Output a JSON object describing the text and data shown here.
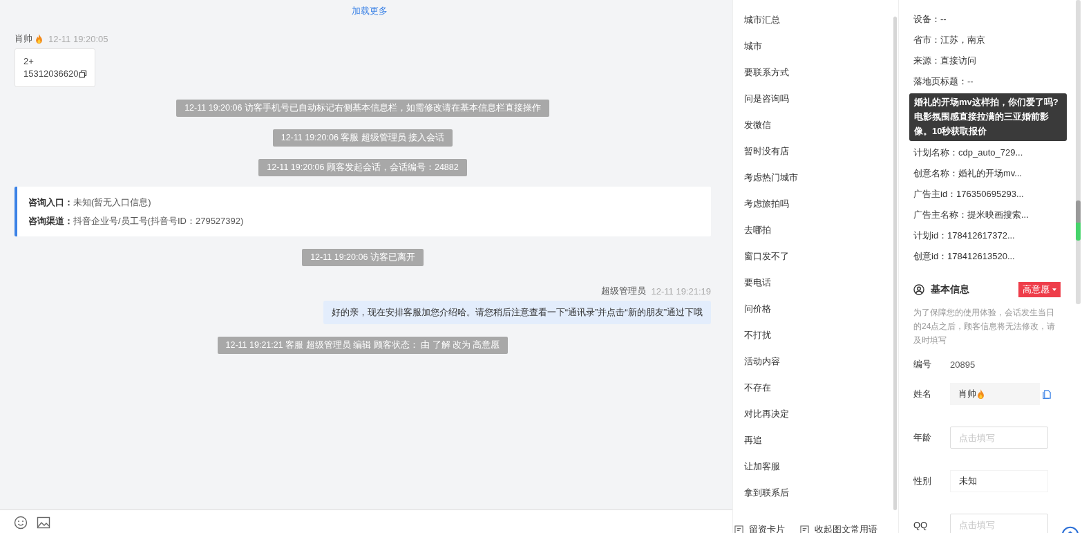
{
  "chat": {
    "load_more": "加载更多",
    "messages": [
      {
        "kind": "visitor",
        "sender": "肖帅",
        "time": "12-11 19:20:05",
        "lines": [
          "2+",
          "15312036620"
        ]
      },
      {
        "kind": "system",
        "text": "12-11 19:20:06 访客手机号已自动标记右侧基本信息栏，如需修改请在基本信息栏直接操作"
      },
      {
        "kind": "system",
        "text": "12-11 19:20:06 客服 超级管理员 接入会话"
      },
      {
        "kind": "system",
        "text": "12-11 19:20:06 顾客发起会话，会话编号：24882"
      },
      {
        "kind": "info",
        "rows": [
          {
            "label": "咨询入口：",
            "value": "未知(暂无入口信息)"
          },
          {
            "label": "咨询渠道：",
            "value": "抖音企业号/员工号(抖音号ID：279527392)"
          }
        ]
      },
      {
        "kind": "system",
        "text": "12-11 19:20:06 访客已离开"
      },
      {
        "kind": "agent",
        "sender": "超级管理员",
        "time": "12-11 19:21:19",
        "text": "好的亲，现在安排客服加您介绍哈。请您稍后注意查看一下“通讯录”并点击“新的朋友”通过下哦"
      },
      {
        "kind": "system",
        "text": "12-11 19:21:21 客服 超级管理员 编辑 顾客状态： 由 了解 改为 高意愿"
      }
    ]
  },
  "quick_replies": {
    "items": [
      "城市汇总",
      "城市",
      "要联系方式",
      "问是咨询吗",
      "发微信",
      "暂时没有店",
      "考虑热门城市",
      "考虑旅拍吗",
      "去哪拍",
      "窗口发不了",
      "要电话",
      "问价格",
      "不打扰",
      "活动内容",
      "不存在",
      "对比再决定",
      "再追",
      "让加客服",
      "拿到联系后"
    ],
    "footer": [
      "留资卡片",
      "收起图文常用语"
    ]
  },
  "visitor_info": {
    "rows": [
      "设备：--",
      "省市：江苏，南京",
      "来源：直接访问",
      "落地页标题：--",
      null,
      "计划名称：cdp_auto_729...",
      "创意名称：婚礼的开场mv...",
      "广告主id：176350695293...",
      "广告主名称：提米映画搜索...",
      "计划id：178412617372...",
      "创意id：178412613520..."
    ],
    "tooltip": "婚礼的开场mv这样拍，你们爱了吗?电影氛围感直接拉满的三亚婚前影像。10秒获取报价"
  },
  "basic_info": {
    "title": "基本信息",
    "tag": "高意愿",
    "note": "为了保障您的使用体验，会话发生当日的24点之后，顾客信息将无法修改，请及时填写",
    "fields": [
      {
        "kind": "text",
        "label": "编号",
        "value": "20895"
      },
      {
        "kind": "readonly",
        "label": "姓名",
        "value": "肖帅"
      },
      {
        "kind": "input",
        "label": "年龄",
        "placeholder": "点击填写"
      },
      {
        "kind": "select",
        "label": "性别",
        "value": "未知"
      },
      {
        "kind": "input",
        "label": "QQ",
        "placeholder": "点击填写"
      }
    ]
  }
}
